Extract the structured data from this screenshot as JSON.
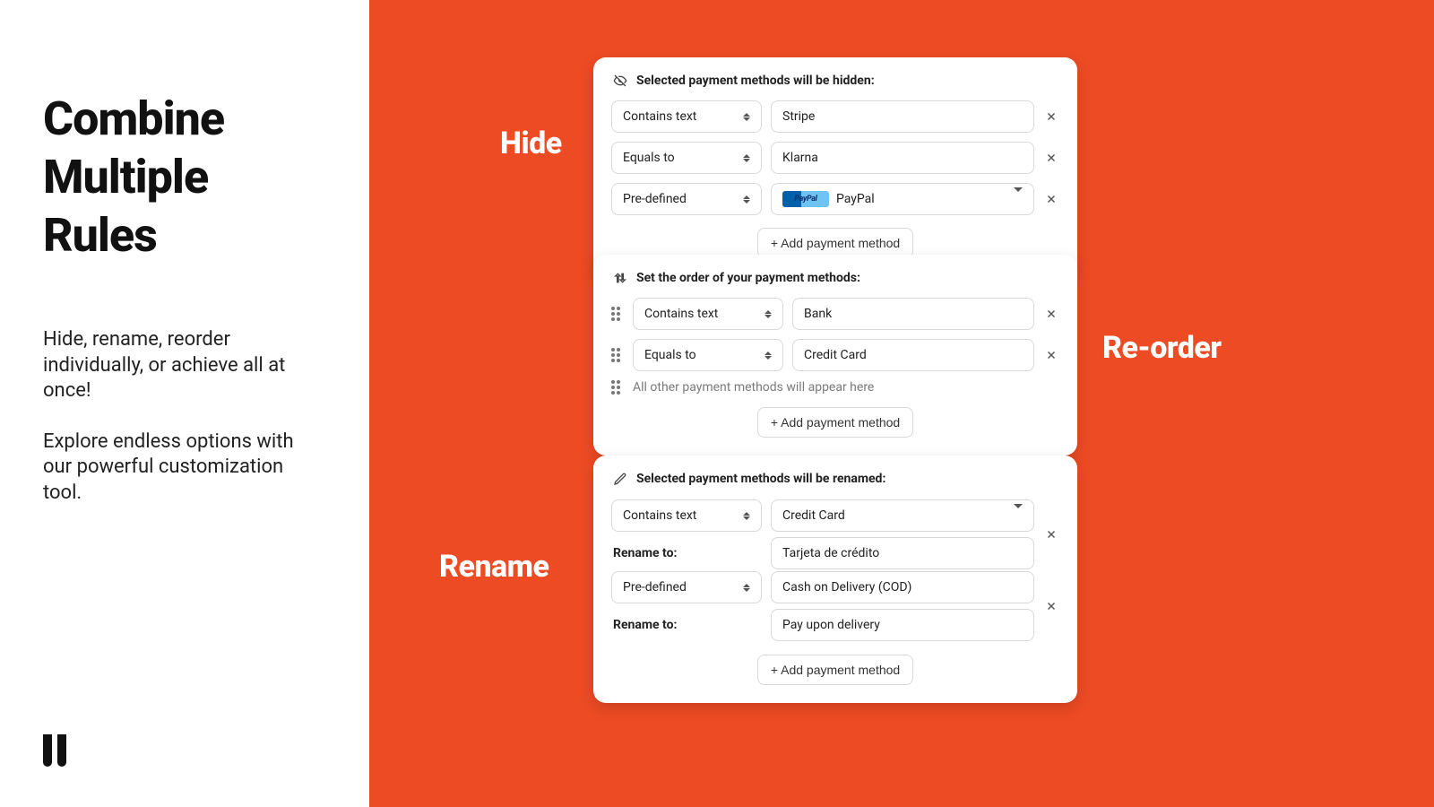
{
  "left": {
    "title_l1": "Combine",
    "title_l2": "Multiple",
    "title_l3": "Rules",
    "desc_p1": "Hide, rename, reorder individually, or achieve all at once!",
    "desc_p2": "Explore endless options with our powerful customization tool."
  },
  "tags": {
    "hide": "Hide",
    "reorder": "Re-order",
    "rename": "Rename"
  },
  "addBtn": "+ Add payment method",
  "hide": {
    "header": "Selected payment methods will be hidden:",
    "rows": [
      {
        "op": "Contains text",
        "val": "Stripe",
        "kind": "text"
      },
      {
        "op": "Equals to",
        "val": "Klarna",
        "kind": "text"
      },
      {
        "op": "Pre-defined",
        "val": "PayPal",
        "kind": "paypal"
      }
    ]
  },
  "reorder": {
    "header": "Set the order of your payment methods:",
    "rows": [
      {
        "op": "Contains text",
        "val": "Bank"
      },
      {
        "op": "Equals to",
        "val": "Credit Card"
      }
    ],
    "hint": "All other payment methods will appear here"
  },
  "rename": {
    "header": "Selected payment methods will be renamed:",
    "label": "Rename to:",
    "groups": [
      {
        "op": "Contains text",
        "val": "Credit Card",
        "kind": "dropdown",
        "renameTo": "Tarjeta de crédito"
      },
      {
        "op": "Pre-defined",
        "val": "Cash on Delivery (COD)",
        "kind": "text",
        "renameTo": "Pay upon delivery"
      }
    ]
  }
}
